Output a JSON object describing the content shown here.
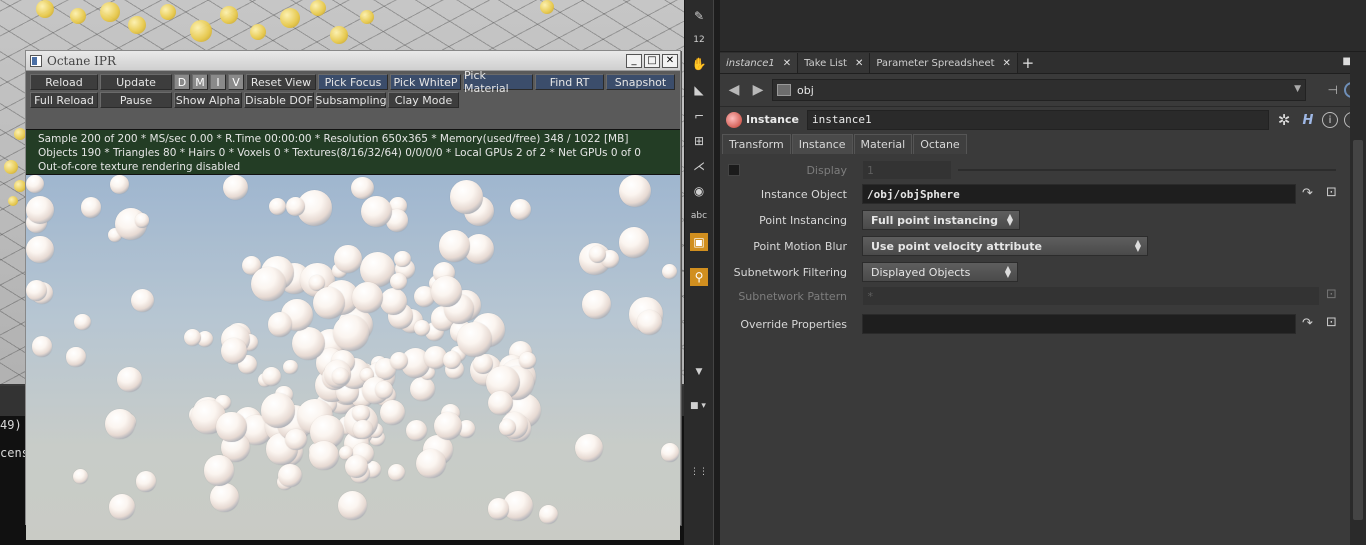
{
  "ipr_window": {
    "title": "Octane IPR",
    "toolbar_row1": [
      "Reload",
      "Update",
      "D",
      "M",
      "I",
      "V",
      "Reset View",
      "Pick Focus",
      "Pick WhiteP",
      "Pick Material",
      "Find RT",
      "Snapshot"
    ],
    "toolbar_row2": [
      "Full Reload",
      "Pause",
      "Show Alpha",
      "Disable DOF",
      "Subsampling",
      "Clay Mode"
    ],
    "status_lines": [
      "Sample 200 of 200 * MS/sec 0.00 * R.Time 00:00:00 * Resolution 650x365 * Memory(used/free) 348 / 1022 [MB]",
      "Objects 190 * Triangles 80 * Hairs 0 * Voxels 0 * Textures(8/16/32/64) 0/0/0/0 * Local GPUs 2 of 2 * Net GPUs 0 of 0",
      "Out-of-core texture rendering disabled"
    ]
  },
  "console": {
    "lines": [
      "49)",
      "cens"
    ]
  },
  "shelf": {
    "icons": [
      "brush-icon",
      "twelve-icon",
      "hand-icon",
      "sculpt-icon",
      "curve-icon",
      "grid-icon",
      "join-icon",
      "circle-icon",
      "abc-icon",
      "image-icon",
      "pin-icon"
    ],
    "twelve_label": "12",
    "abc_label": "abc"
  },
  "tabs": [
    {
      "label": "instance1"
    },
    {
      "label": "Take List"
    },
    {
      "label": "Parameter Spreadsheet"
    }
  ],
  "path": {
    "value": "obj"
  },
  "node": {
    "type": "Instance",
    "name": "instance1"
  },
  "subtabs": [
    "Transform",
    "Instance",
    "Material",
    "Octane"
  ],
  "params": {
    "display": {
      "label": "Display",
      "value": "1"
    },
    "instance_object": {
      "label": "Instance Object",
      "value": "/obj/objSphere"
    },
    "point_instancing": {
      "label": "Point Instancing",
      "value": "Full point instancing"
    },
    "point_motion_blur": {
      "label": "Point Motion Blur",
      "value": "Use point velocity attribute"
    },
    "subnetwork_filtering": {
      "label": "Subnetwork Filtering",
      "value": "Displayed Objects"
    },
    "subnetwork_pattern": {
      "label": "Subnetwork Pattern",
      "value": "*"
    },
    "override_properties": {
      "label": "Override Properties",
      "value": ""
    }
  },
  "colors": {
    "status_bg": "#233d25",
    "accent_orange": "#d18f1f",
    "toolbar_blue": "#3b4d6b"
  }
}
